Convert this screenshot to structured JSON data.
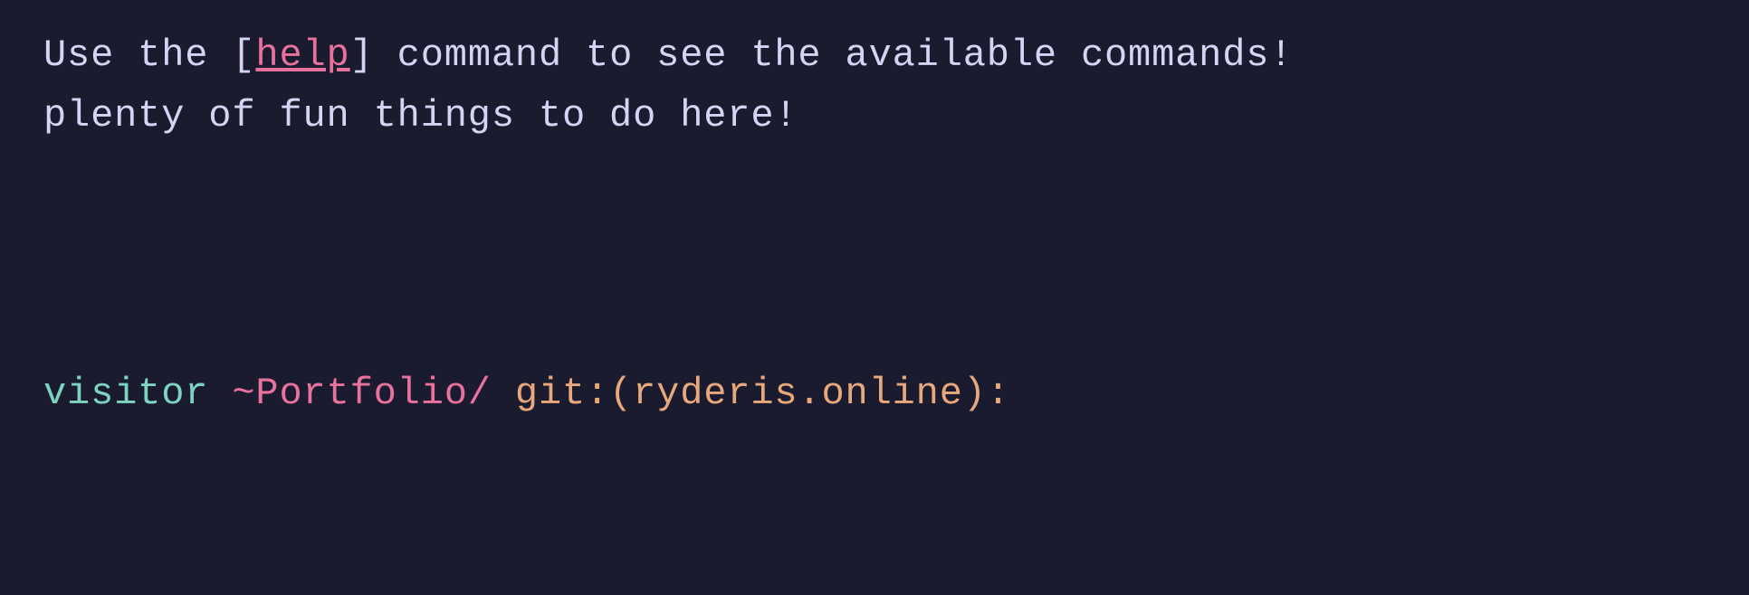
{
  "message": {
    "line1_prefix": "Use the ",
    "line1_bracket_open": "[",
    "line1_help": "help",
    "line1_bracket_close": "]",
    "line1_suffix": " command to see the available commands!",
    "line2": "plenty of fun things to do here!"
  },
  "prompt": {
    "user": "visitor",
    "path": "~Portfolio/",
    "git_label": "git:",
    "git_branch_open": "(",
    "git_branch": "ryderis.online",
    "git_branch_close": ")",
    "colon": ":"
  },
  "input": {
    "value": ""
  }
}
